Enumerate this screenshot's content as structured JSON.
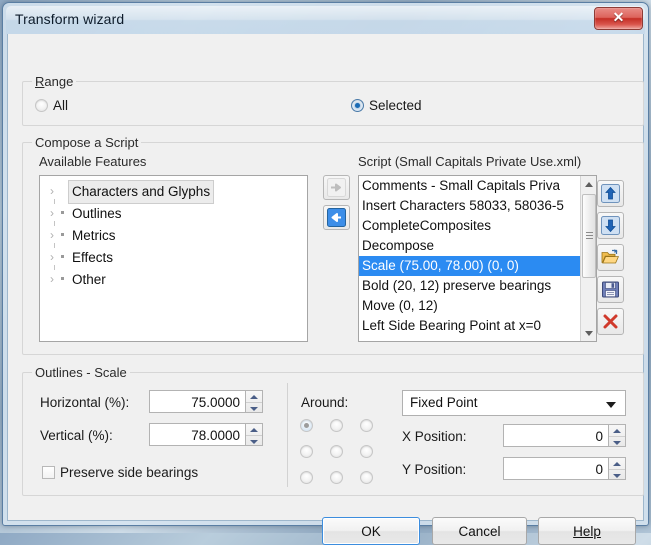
{
  "window": {
    "title": "Transform wizard",
    "close_label": "✕"
  },
  "range": {
    "legend": "Range",
    "options": [
      {
        "label": "All",
        "selected": false
      },
      {
        "label": "Selected",
        "selected": true
      }
    ]
  },
  "compose": {
    "legend": "Compose a Script",
    "available_label": "Available Features",
    "features": [
      "Characters and Glyphs",
      "Outlines",
      "Metrics",
      "Effects",
      "Other"
    ],
    "selected_feature": "Characters and Glyphs",
    "script_label": "Script (Small Capitals Private Use.xml)",
    "script_items": [
      "Comments - Small Capitals Priva",
      "Insert Characters 58033, 58036-5",
      "CompleteComposites",
      "Decompose",
      "Scale (75.00, 78.00) (0, 0)",
      "Bold (20, 12) preserve bearings",
      "Move (0, 12)",
      "Left Side Bearing Point at x=0"
    ],
    "selected_script_index": 4,
    "transfer_buttons": [
      {
        "name": "add-to-script",
        "icon": "arrow-right-icon",
        "enabled": false
      },
      {
        "name": "remove-from-script",
        "icon": "arrow-left-icon",
        "enabled": true
      }
    ],
    "tools": [
      {
        "name": "move-up-button",
        "icon": "arrow-up-icon"
      },
      {
        "name": "move-down-button",
        "icon": "arrow-down-icon"
      },
      {
        "name": "open-script-button",
        "icon": "open-folder-icon"
      },
      {
        "name": "save-script-button",
        "icon": "floppy-disk-icon"
      },
      {
        "name": "delete-entry-button",
        "icon": "red-x-icon"
      }
    ]
  },
  "outlines": {
    "legend": "Outlines - Scale",
    "horizontal_label": "Horizontal (%):",
    "horizontal_value": "75.0000",
    "vertical_label": "Vertical (%):",
    "vertical_value": "78.0000",
    "preserve_label": "Preserve side bearings",
    "preserve_checked": false,
    "around_label": "Around:",
    "around_selected_index": 0,
    "around_cells": 9,
    "fixed_point_value": "Fixed Point",
    "x_position_label": "X Position:",
    "x_position_value": "0",
    "y_position_label": "Y Position:",
    "y_position_value": "0"
  },
  "footer": {
    "ok": "OK",
    "cancel": "Cancel",
    "help": "Help"
  },
  "colors": {
    "accent": "#2b8bf2",
    "dialog_bg": "#f0f0f0",
    "close_red": "#c42e25"
  }
}
